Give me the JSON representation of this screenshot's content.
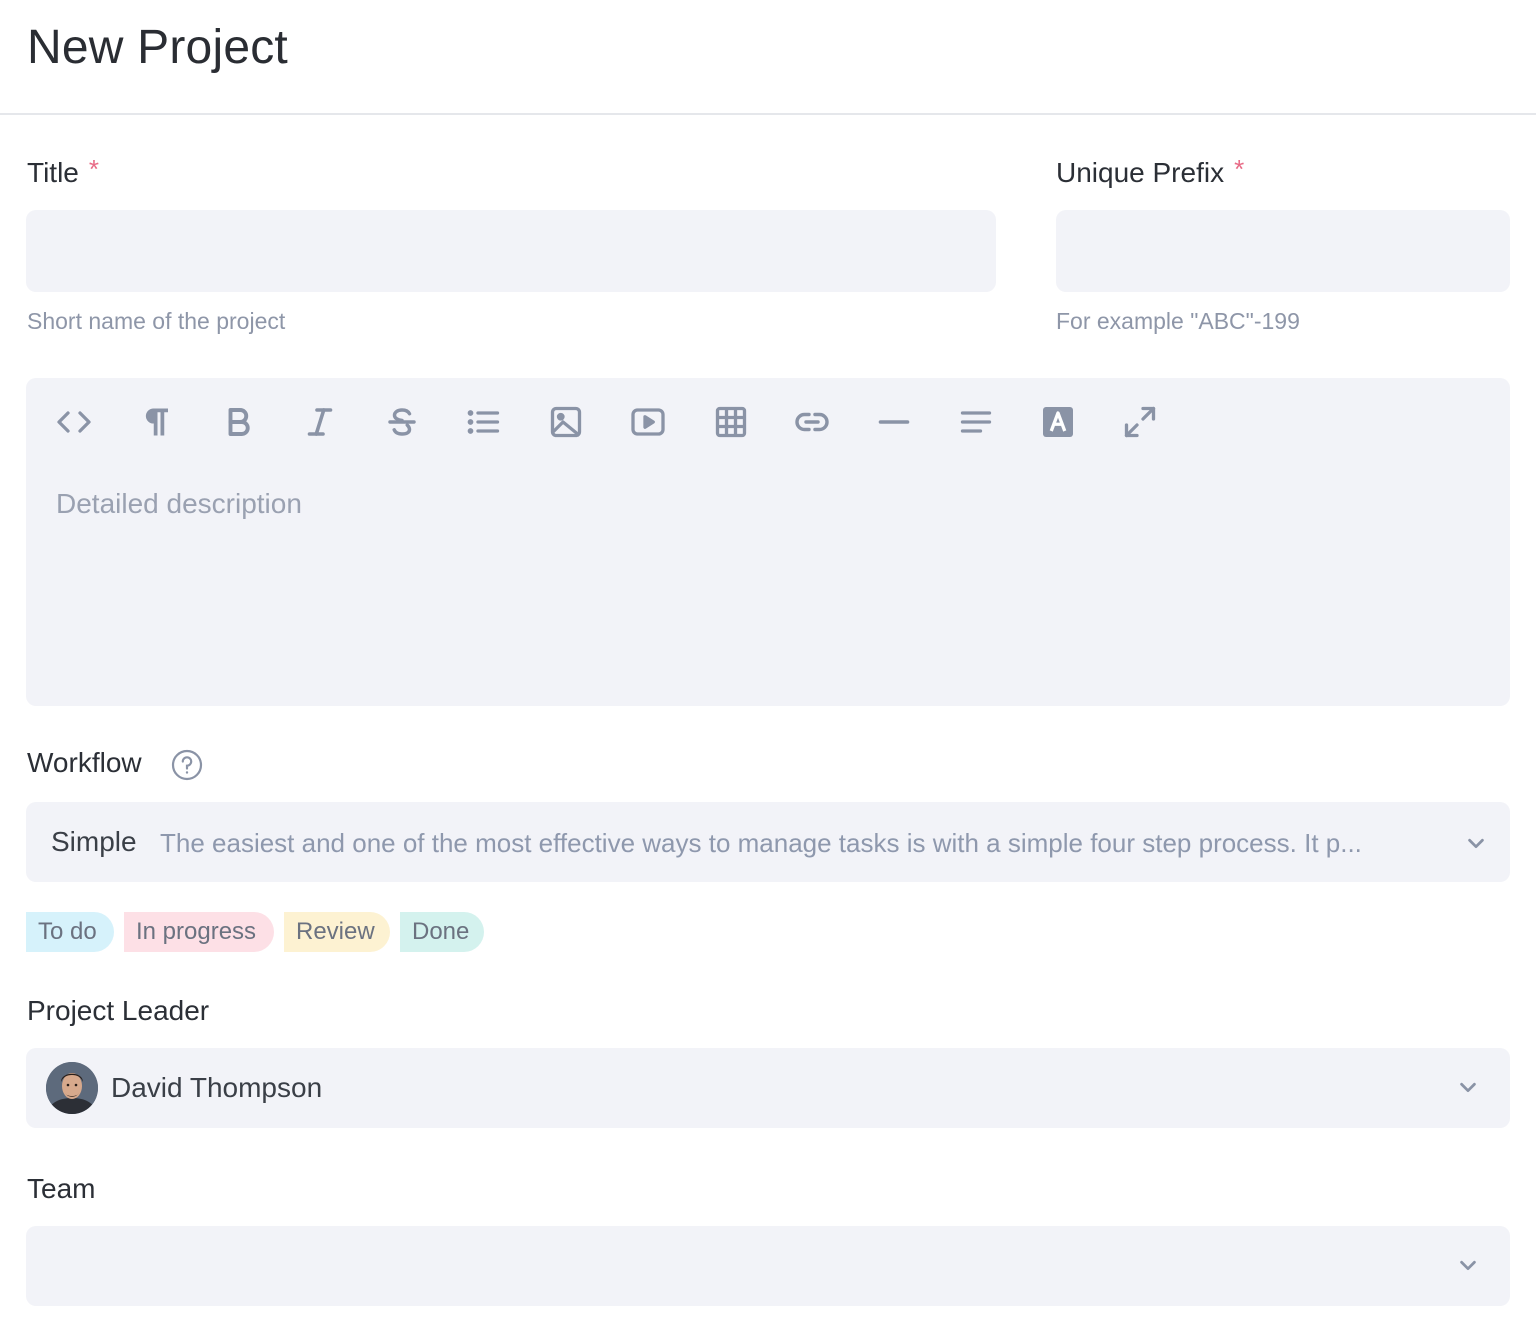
{
  "page": {
    "title": "New Project"
  },
  "title_field": {
    "label": "Title",
    "required": "*",
    "value": "",
    "hint": "Short name of the project"
  },
  "prefix_field": {
    "label": "Unique Prefix",
    "required": "*",
    "value": "",
    "hint": "For example \"ABC\"-199"
  },
  "editor": {
    "toolbar": [
      "code-icon",
      "paragraph-icon",
      "bold-icon",
      "italic-icon",
      "strikethrough-icon",
      "list-icon",
      "image-icon",
      "video-icon",
      "table-icon",
      "link-icon",
      "horizontal-rule-icon",
      "align-icon",
      "text-color-icon",
      "fullscreen-icon"
    ],
    "placeholder": "Detailed description"
  },
  "workflow": {
    "label": "Workflow",
    "selected_name": "Simple",
    "selected_desc": "The easiest and one of the most effective ways to manage tasks is with a simple four step process. It p...",
    "statuses": [
      "To do",
      "In progress",
      "Review",
      "Done"
    ]
  },
  "leader": {
    "label": "Project Leader",
    "name": "David Thompson"
  },
  "team": {
    "label": "Team",
    "value": ""
  },
  "colors": {
    "field_bg": "#f2f3f8",
    "required": "#e86b86",
    "icon": "#8a93a6"
  }
}
